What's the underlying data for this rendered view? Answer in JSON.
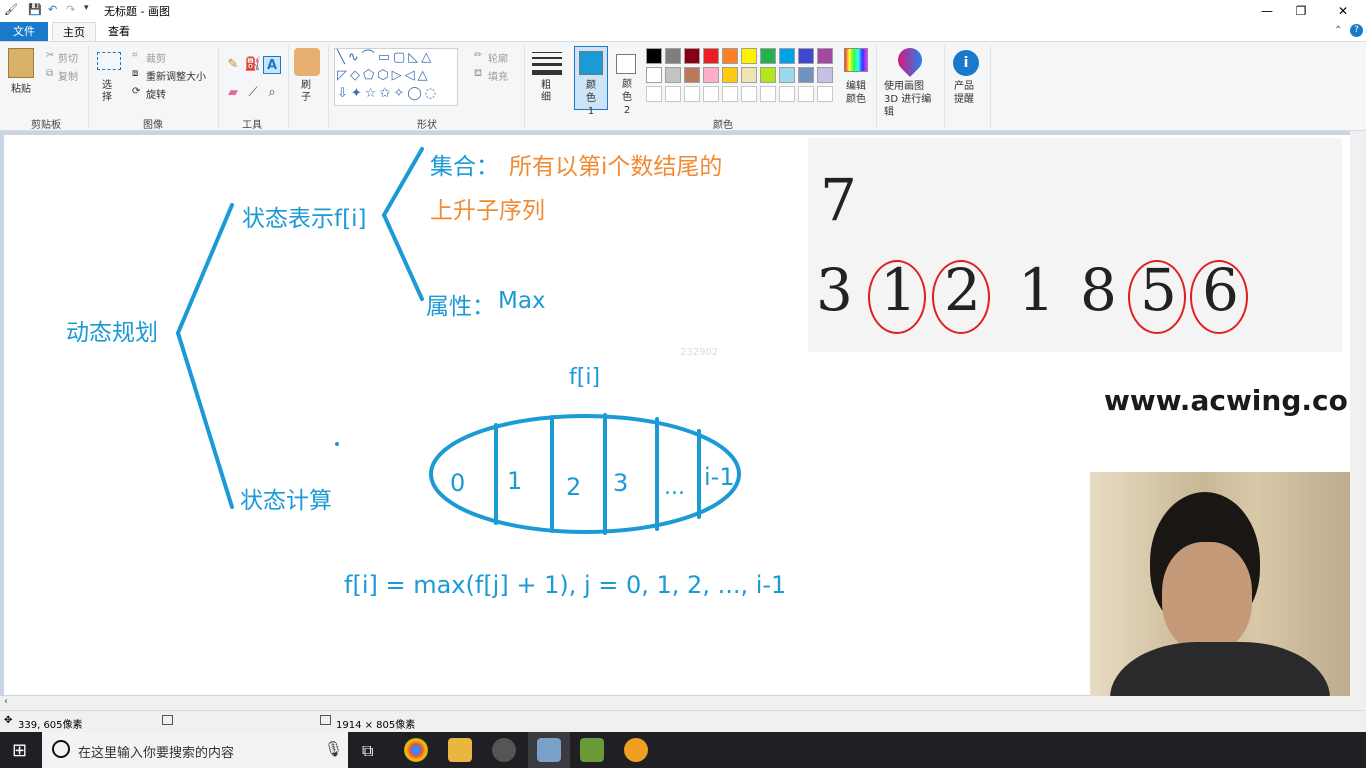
{
  "window": {
    "title": "无标题 - 画图",
    "min_label": "—",
    "max_label": "❐",
    "close_label": "✕"
  },
  "tabs": {
    "file": "文件",
    "home": "主页",
    "view": "查看"
  },
  "ribbon": {
    "clipboard": {
      "paste": "粘贴",
      "cut": "剪切",
      "copy": "复制",
      "group": "剪贴板"
    },
    "image": {
      "select": "选择",
      "crop": "裁剪",
      "resize": "重新调整大小",
      "rotate": "旋转",
      "group": "图像"
    },
    "tools": {
      "group": "工具"
    },
    "brushes": {
      "label": "刷子"
    },
    "shapes": {
      "outline": "轮廓",
      "fill": "填充",
      "group": "形状"
    },
    "size": {
      "label": "粗细"
    },
    "colors": {
      "color1": "颜色 1",
      "color2": "颜色 2",
      "edit": "编辑颜色",
      "group": "颜色",
      "color1_value": "#1c9ad6",
      "color2_value": "#ffffff",
      "palette_row1": [
        "#000000",
        "#7f7f7f",
        "#880015",
        "#ed1c24",
        "#ff7f27",
        "#fff200",
        "#22b14c",
        "#00a2e8",
        "#3f48cc",
        "#a349a4"
      ],
      "palette_row2": [
        "#ffffff",
        "#c3c3c3",
        "#b97a57",
        "#ffaec9",
        "#ffc90e",
        "#efe4b0",
        "#b5e61d",
        "#99d9ea",
        "#7092be",
        "#c8bfe7"
      ]
    },
    "paint3d": "使用画图 3D 进行编辑",
    "product": "产品提醒"
  },
  "canvas": {
    "root": "动态规划",
    "state_repr": "状态表示f[i]",
    "set_prefix": "集合：",
    "set_line1": "所有以第i个数结尾的",
    "set_line2": "上升子序列",
    "attr_label": "属性：",
    "attr_value": "Max",
    "state_calc": "状态计算",
    "fi_label": "f[i]",
    "small_number": "232902",
    "cells": [
      "0",
      "1",
      "2",
      "3",
      "...",
      "i-1"
    ],
    "formula": "f[i] = max(f[j] + 1), j = 0, 1, 2, ..., i-1",
    "sample_n": "7",
    "sample_seq": [
      "3",
      "1",
      "2",
      "1",
      "8",
      "5",
      "6"
    ],
    "circled_indices": [
      1,
      2,
      5,
      6
    ],
    "watermark": "www.acwing.com"
  },
  "status": {
    "cursor_pos": "339, 605像素",
    "canvas_size": "1914 × 805像素"
  },
  "taskbar": {
    "search_placeholder": "在这里输入你要搜索的内容"
  }
}
